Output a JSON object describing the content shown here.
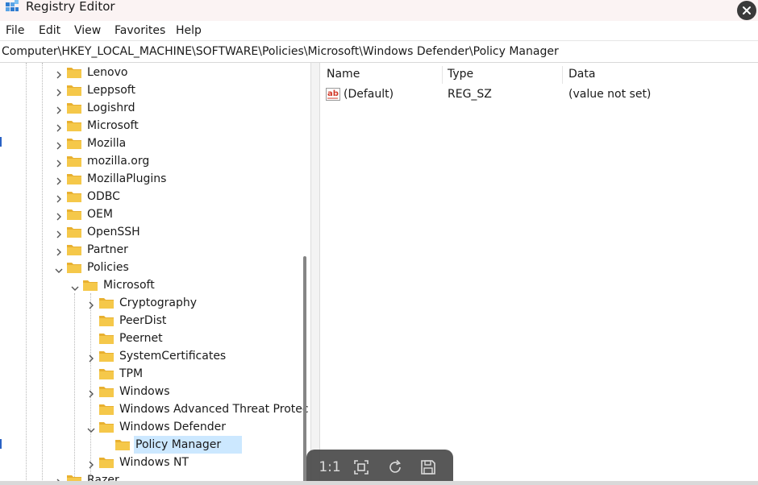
{
  "window": {
    "title": "Registry Editor",
    "icon": "registry-icon",
    "close_icon": "close-icon"
  },
  "menu": [
    "File",
    "Edit",
    "View",
    "Favorites",
    "Help"
  ],
  "address": "Computer\\HKEY_LOCAL_MACHINE\\SOFTWARE\\Policies\\Microsoft\\Windows Defender\\Policy Manager",
  "tree": {
    "items": [
      {
        "label": "Lenovo",
        "expander": "collapsed"
      },
      {
        "label": "Leppsoft",
        "expander": "collapsed"
      },
      {
        "label": "Logishrd",
        "expander": "collapsed"
      },
      {
        "label": "Microsoft",
        "expander": "collapsed"
      },
      {
        "label": "Mozilla",
        "expander": "collapsed"
      },
      {
        "label": "mozilla.org",
        "expander": "collapsed"
      },
      {
        "label": "MozillaPlugins",
        "expander": "collapsed"
      },
      {
        "label": "ODBC",
        "expander": "collapsed"
      },
      {
        "label": "OEM",
        "expander": "collapsed"
      },
      {
        "label": "OpenSSH",
        "expander": "collapsed"
      },
      {
        "label": "Partner",
        "expander": "collapsed"
      },
      {
        "label": "Policies",
        "expander": "expanded"
      },
      {
        "label": "Microsoft",
        "expander": "expanded"
      },
      {
        "label": "Cryptography",
        "expander": "collapsed"
      },
      {
        "label": "PeerDist",
        "expander": "none"
      },
      {
        "label": "Peernet",
        "expander": "none"
      },
      {
        "label": "SystemCertificates",
        "expander": "collapsed"
      },
      {
        "label": "TPM",
        "expander": "none"
      },
      {
        "label": "Windows",
        "expander": "collapsed"
      },
      {
        "label": "Windows Advanced Threat Protec",
        "expander": "none"
      },
      {
        "label": "Windows Defender",
        "expander": "expanded"
      },
      {
        "label": "Policy Manager",
        "expander": "none",
        "selected": true
      },
      {
        "label": "Windows NT",
        "expander": "collapsed"
      },
      {
        "label": "Razer",
        "expander": "collapsed"
      }
    ]
  },
  "list": {
    "columns": [
      "Name",
      "Type",
      "Data"
    ],
    "rows": [
      {
        "icon": "string-value-icon",
        "name": "(Default)",
        "type": "REG_SZ",
        "data": "(value not set)"
      }
    ]
  },
  "viewer_toolbar": {
    "actual_size_label": "1:1",
    "buttons": [
      "fit-to-screen-icon",
      "rotate-icon",
      "save-icon"
    ]
  },
  "colors": {
    "selection": "#cce8ff",
    "folder": "#f5c342",
    "toolbar": "#4a4a4a"
  }
}
